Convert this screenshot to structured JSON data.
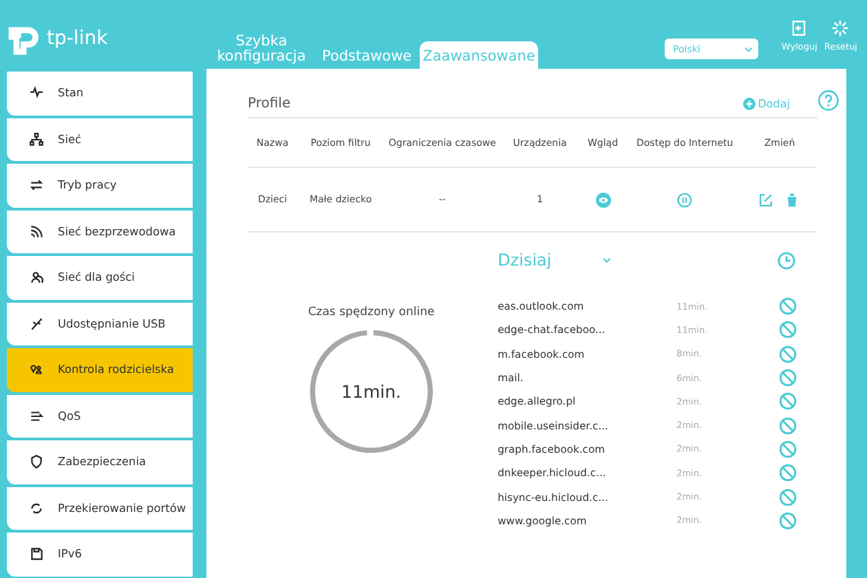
{
  "header": {
    "logo": "tp-link",
    "tabs": [
      {
        "label": "Szybka konfiguracja",
        "selected": false
      },
      {
        "label": "Podstawowe",
        "selected": false
      },
      {
        "label": "Zaawansowane",
        "selected": true
      }
    ],
    "language": "Polski",
    "actions": [
      "Wyloguj",
      "Resetuj"
    ]
  },
  "sidebar": {
    "items": [
      {
        "label": "Stan",
        "selected": false
      },
      {
        "label": "Sieć",
        "selected": false
      },
      {
        "label": "Tryb pracy",
        "selected": false
      },
      {
        "label": "Sieć bezprzewodowa",
        "selected": false
      },
      {
        "label": "Sieć dla gości",
        "selected": false
      },
      {
        "label": "Udostępnianie USB",
        "selected": false
      },
      {
        "label": "Kontrola rodzicielska",
        "selected": true
      },
      {
        "label": "QoS",
        "selected": false
      },
      {
        "label": "Zabezpieczenia",
        "selected": false
      },
      {
        "label": "Przekierowanie portów",
        "selected": false
      },
      {
        "label": "IPv6",
        "selected": false
      }
    ]
  },
  "profiles": {
    "title": "Profile",
    "add": "Dodaj",
    "columns": [
      "Nazwa",
      "Poziom filtru",
      "Ograniczenia czasowe",
      "Urządzenia",
      "Wgląd",
      "Dostęp do Internetu",
      "Zmień"
    ],
    "rows": [
      {
        "name": "Dzieci",
        "filter": "Małe dziecko",
        "time_limits": "--",
        "devices": "1"
      }
    ]
  },
  "insight": {
    "period": "Dzisiaj",
    "online_label": "Czas spędzony online",
    "online_total": "11min.",
    "sites": [
      {
        "domain": "eas.outlook.com",
        "time": "11min."
      },
      {
        "domain": "edge-chat.faceboo...",
        "time": "11min."
      },
      {
        "domain": "m.facebook.com",
        "time": "8min."
      },
      {
        "domain": "mail.",
        "time": "6min."
      },
      {
        "domain": "edge.allegro.pl",
        "time": "2min."
      },
      {
        "domain": "mobile.useinsider.c...",
        "time": "2min."
      },
      {
        "domain": "graph.facebook.com",
        "time": "2min."
      },
      {
        "domain": "dnkeeper.hicloud.c...",
        "time": "2min."
      },
      {
        "domain": "hisync-eu.hicloud.c...",
        "time": "2min."
      },
      {
        "domain": "www.google.com",
        "time": "2min."
      }
    ]
  }
}
